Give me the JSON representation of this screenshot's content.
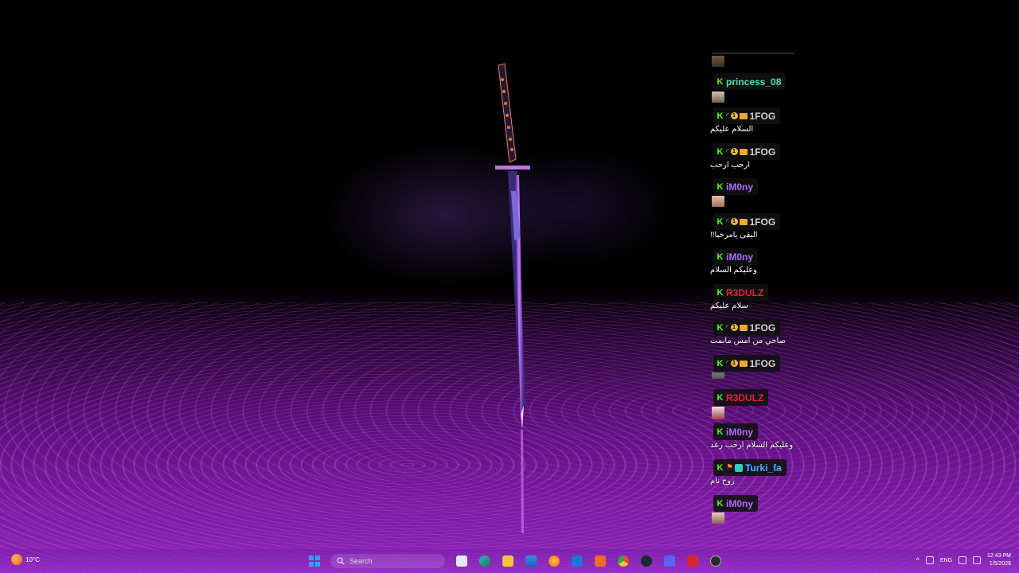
{
  "desktop": {
    "wallpaper": "katana-in-purple-water"
  },
  "chat": {
    "messages": [
      {
        "user": "princess_08",
        "color": "#4fe3b2",
        "badges": [
          "kick"
        ],
        "message": "",
        "emote": true
      },
      {
        "user": "1FOG",
        "color": "#d0d0d0",
        "badges": [
          "kick",
          "moon",
          "coin",
          "box"
        ],
        "message": "السلام عليكم",
        "emote": false
      },
      {
        "user": "1FOG",
        "color": "#d0d0d0",
        "badges": [
          "kick",
          "moon",
          "coin",
          "box"
        ],
        "message": "ارحب ارحب",
        "emote": false
      },
      {
        "user": "iM0ny",
        "color": "#b06cff",
        "badges": [
          "kick"
        ],
        "message": "",
        "emote": true
      },
      {
        "user": "1FOG",
        "color": "#d0d0d0",
        "badges": [
          "kick",
          "moon",
          "coin",
          "box"
        ],
        "message": "البقى يامرحبا!!",
        "emote": false
      },
      {
        "user": "iM0ny",
        "color": "#b06cff",
        "badges": [
          "kick"
        ],
        "message": "وعليكم السلام",
        "emote": false
      },
      {
        "user": "R3DULZ",
        "color": "#e0263c",
        "badges": [
          "kick"
        ],
        "message": "سلام عليكم",
        "emote": false
      },
      {
        "user": "1FOG",
        "color": "#d0d0d0",
        "badges": [
          "kick",
          "moon",
          "coin",
          "box"
        ],
        "message": "صاحي من امس مانمت",
        "emote": false
      },
      {
        "user": "1FOG",
        "color": "#d0d0d0",
        "badges": [
          "kick",
          "moon",
          "coin",
          "box"
        ],
        "message": "",
        "emote": true
      },
      {
        "user": "R3DULZ",
        "color": "#e0263c",
        "badges": [
          "kick"
        ],
        "message": "",
        "emote": true
      },
      {
        "user": "iM0ny",
        "color": "#b06cff",
        "badges": [
          "kick"
        ],
        "message": "وعليكم السلام ارحب رعد",
        "emote": false
      },
      {
        "user": "Turki_fa",
        "color": "#3fb7ff",
        "badges": [
          "kick",
          "fire",
          "gift"
        ],
        "message": "روح نام",
        "emote": false
      },
      {
        "user": "iM0ny",
        "color": "#b06cff",
        "badges": [
          "kick"
        ],
        "message": "",
        "emote": true
      }
    ]
  },
  "taskbar": {
    "weather": {
      "temp": "10°C",
      "icon": "weather-sun-icon"
    },
    "search_placeholder": "Search",
    "apps": [
      "file-icon",
      "edge-icon",
      "folder-icon",
      "store-icon",
      "firefox-icon",
      "outlook-icon",
      "office-icon",
      "chrome-icon",
      "steam-icon",
      "discord-icon",
      "app-red-icon",
      "obs-icon"
    ],
    "tray": {
      "language": "ENG",
      "time": "12:43 PM",
      "date": "1/5/2026"
    }
  }
}
